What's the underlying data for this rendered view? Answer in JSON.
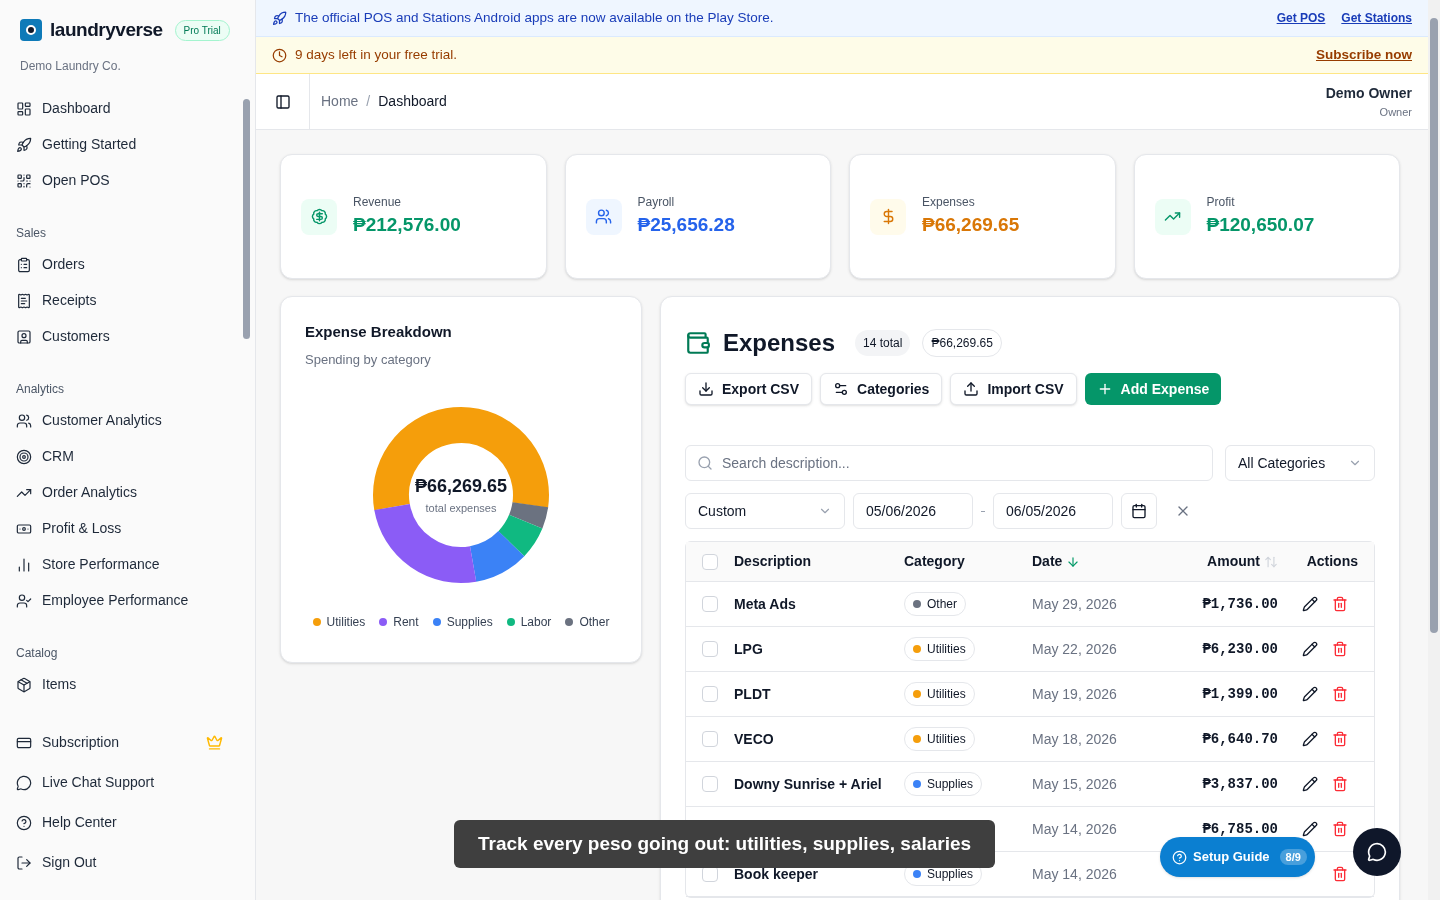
{
  "brand": {
    "name": "laundryverse",
    "badge": "Pro Trial",
    "company": "Demo Laundry Co."
  },
  "sidebar": {
    "top_items": [
      {
        "label": "Dashboard"
      },
      {
        "label": "Getting Started"
      },
      {
        "label": "Open POS"
      }
    ],
    "sections": [
      {
        "title": "Sales",
        "items": [
          {
            "label": "Orders"
          },
          {
            "label": "Receipts"
          },
          {
            "label": "Customers"
          }
        ]
      },
      {
        "title": "Analytics",
        "items": [
          {
            "label": "Customer Analytics"
          },
          {
            "label": "CRM"
          },
          {
            "label": "Order Analytics"
          },
          {
            "label": "Profit & Loss"
          },
          {
            "label": "Store Performance"
          },
          {
            "label": "Employee Performance"
          }
        ]
      },
      {
        "title": "Catalog",
        "items": [
          {
            "label": "Items"
          }
        ]
      }
    ],
    "bottom_items": [
      {
        "label": "Subscription",
        "premium": true
      },
      {
        "label": "Live Chat Support",
        "premium": false
      },
      {
        "label": "Help Center",
        "premium": false
      },
      {
        "label": "Sign Out",
        "premium": false
      }
    ]
  },
  "announcement": {
    "text": "The official POS and Stations Android apps are now available on the Play Store.",
    "links": [
      "Get POS",
      "Get Stations"
    ]
  },
  "trial_banner": {
    "text": "9 days left in your free trial.",
    "link": "Subscribe now"
  },
  "breadcrumb": {
    "items": [
      "Home",
      "Dashboard"
    ],
    "separator": "/"
  },
  "user": {
    "name": "Demo Owner",
    "role": "Owner"
  },
  "stats": [
    {
      "label": "Revenue",
      "value": "₱212,576.00",
      "color": "#059669"
    },
    {
      "label": "Payroll",
      "value": "₱25,656.28",
      "color": "#2563eb"
    },
    {
      "label": "Expenses",
      "value": "₱66,269.65",
      "color": "#d97706"
    },
    {
      "label": "Profit",
      "value": "₱120,650.07",
      "color": "#059669"
    }
  ],
  "breakdown": {
    "title": "Expense Breakdown",
    "subtitle": "Spending by category",
    "center_value": "₱66,269.65",
    "center_label": "total expenses",
    "legend": [
      {
        "label": "Utilities",
        "color": "#f59e0b"
      },
      {
        "label": "Rent",
        "color": "#8b5cf6"
      },
      {
        "label": "Supplies",
        "color": "#3b82f6"
      },
      {
        "label": "Labor",
        "color": "#10b981"
      },
      {
        "label": "Other",
        "color": "#6b7280"
      }
    ]
  },
  "expenses": {
    "title": "Expenses",
    "count": "14 total",
    "total": "₱66,269.65",
    "actions": [
      "Export CSV",
      "Categories",
      "Import CSV",
      "Add Expense"
    ],
    "search": {
      "placeholder": "Search description..."
    },
    "category_filter": "All Categories",
    "range": "Custom",
    "date_from": "05/06/2026",
    "date_to": "06/05/2026",
    "all_checked": false,
    "columns": [
      {
        "label": "Description"
      },
      {
        "label": "Category"
      },
      {
        "label": "Date",
        "sorted": true
      },
      {
        "label": "Amount",
        "sorted": false
      },
      {
        "label": "Actions"
      }
    ],
    "rows": [
      {
        "checked": false,
        "description": "Meta Ads",
        "category": "Other",
        "color": "#6b7280",
        "date": "May 29, 2026",
        "amount": "₱1,736.00"
      },
      {
        "checked": false,
        "description": "LPG",
        "category": "Utilities",
        "color": "#f59e0b",
        "date": "May 22, 2026",
        "amount": "₱6,230.00"
      },
      {
        "checked": false,
        "description": "PLDT",
        "category": "Utilities",
        "color": "#f59e0b",
        "date": "May 19, 2026",
        "amount": "₱1,399.00"
      },
      {
        "checked": false,
        "description": "VECO",
        "category": "Utilities",
        "color": "#f59e0b",
        "date": "May 18, 2026",
        "amount": "₱6,640.70"
      },
      {
        "checked": false,
        "description": "Downy Sunrise + Ariel",
        "category": "Supplies",
        "color": "#3b82f6",
        "date": "May 15, 2026",
        "amount": "₱3,837.00"
      },
      {
        "date": "May 14, 2026",
        "amount": "₱6,785.00"
      },
      {
        "checked": false,
        "description": "Book keeper",
        "category": "Supplies",
        "color": "#3b82f6",
        "date": "May 14, 2026"
      }
    ]
  },
  "toast": "Track every peso going out: utilities, supplies, salaries",
  "setup_guide": {
    "label": "Setup Guide",
    "progress": "8/9"
  }
}
